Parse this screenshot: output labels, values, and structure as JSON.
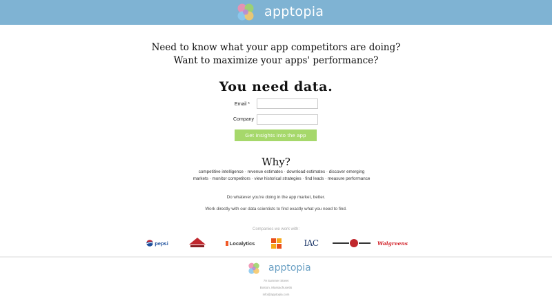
{
  "header": {
    "brand": "apptopia"
  },
  "hero": {
    "line1": "Need to know what your app competitors are doing?",
    "line2": "Want to maximize your apps' performance?",
    "line3": "You need data."
  },
  "form": {
    "email_label": "Email *",
    "email_value": "",
    "company_label": "Company",
    "company_value": "",
    "submit_label": "Get insights into the app"
  },
  "why": {
    "title": "Why?",
    "features": "competitive intelligence · revenue estimates · download estimates · discover emerging markets · monitor competitors · view historical strategies · find leads · measure performance",
    "tagline": "Do whatever you're doing in the app market, better.",
    "work": "Work directly with our data scientists to find exactly what you need to find."
  },
  "companies": {
    "label": "Companies we work with:",
    "logos": [
      "pepsi",
      "Localytics",
      "IAC",
      "Walgreens"
    ]
  },
  "footer": {
    "brand": "apptopia",
    "line1": "79 Summer Street",
    "line2": "Boston, Massachusetts",
    "line3": "info@apptopia.com"
  },
  "colors": {
    "header_bg": "#7fb3d3",
    "cta_bg": "#a6d86b",
    "footer_brand": "#6aa0c4"
  }
}
